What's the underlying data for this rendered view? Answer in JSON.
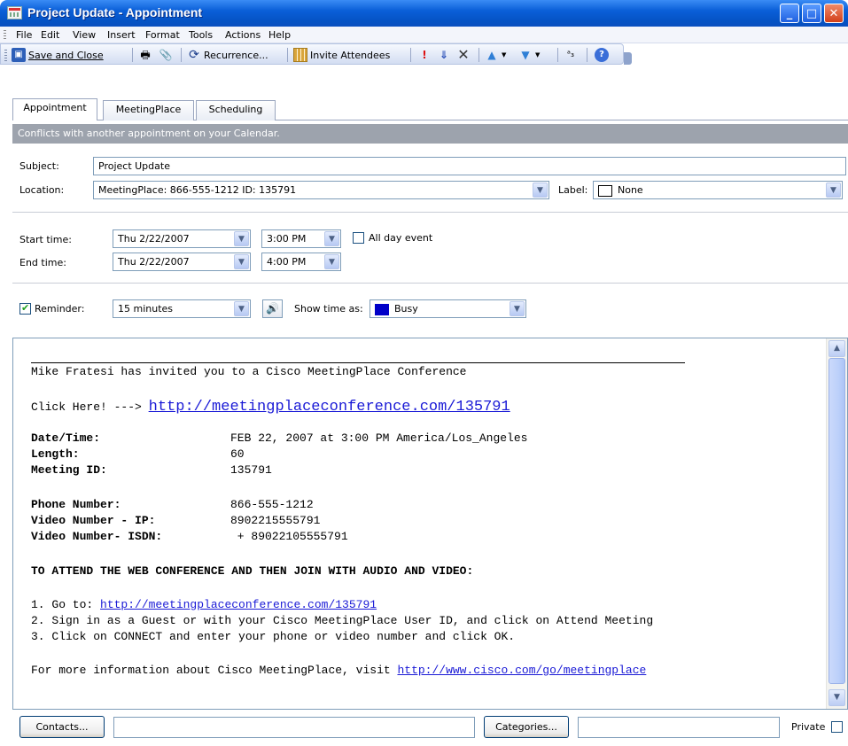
{
  "window": {
    "title": "Project Update - Appointment"
  },
  "menu": [
    "File",
    "Edit",
    "View",
    "Insert",
    "Format",
    "Tools",
    "Actions",
    "Help"
  ],
  "toolbar": {
    "save_close": "Save and Close",
    "recurrence": "Recurrence...",
    "invite": "Invite Attendees"
  },
  "tabs": [
    "Appointment",
    "MeetingPlace",
    "Scheduling"
  ],
  "infobar": "Conflicts with another appointment on your Calendar.",
  "form": {
    "subject_label": "Subject:",
    "subject_value": "Project Update",
    "location_label": "Location:",
    "location_value": "MeetingPlace: 866-555-1212 ID: 135791",
    "label_label": "Label:",
    "label_value": "None",
    "start_label": "Start time:",
    "start_date": "Thu 2/22/2007",
    "start_time": "3:00 PM",
    "allday_label": "All day event",
    "end_label": "End time:",
    "end_date": "Thu 2/22/2007",
    "end_time": "4:00 PM",
    "reminder_label": "Reminder:",
    "reminder_value": "15 minutes",
    "showas_label": "Show time as:",
    "showas_value": "Busy",
    "busy_color": "#0000c8"
  },
  "body": {
    "invite_line": "Mike Fratesi has invited you to a Cisco MeetingPlace Conference",
    "click_here": "Click Here! --->",
    "main_link": "http://meetingplaceconference.com/135791",
    "datetime_label": "Date/Time:",
    "datetime_value": "FEB 22, 2007 at 3:00 PM America/Los_Angeles",
    "length_label": "Length:",
    "length_value": "60",
    "meetingid_label": "Meeting ID:",
    "meetingid_value": "135791",
    "phone_label": "Phone Number:",
    "phone_value": "866-555-1212",
    "videoip_label": "Video Number - IP:",
    "videoip_value": "8902215555791",
    "videoisdn_label": "Video Number- ISDN:",
    "videoisdn_value": " + 89022105555791",
    "attend_heading": "TO ATTEND THE WEB CONFERENCE AND THEN JOIN WITH AUDIO AND VIDEO:",
    "step1_prefix": "1. Go to: ",
    "step1_link": "http://meetingplaceconference.com/135791",
    "step2": "2. Sign in as a Guest or with your Cisco MeetingPlace User ID, and click on Attend Meeting",
    "step3": "3. Click on CONNECT and enter your phone or video number and click OK.",
    "moreinfo_prefix": "For more information about Cisco MeetingPlace, visit ",
    "moreinfo_link": "http://www.cisco.com/go/meetingplace"
  },
  "bottom": {
    "contacts": "Contacts...",
    "categories": "Categories...",
    "private": "Private"
  }
}
